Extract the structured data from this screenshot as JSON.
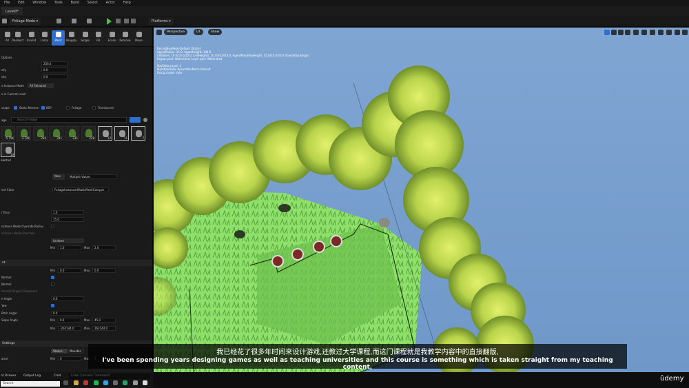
{
  "menu": [
    "File",
    "Edit",
    "Window",
    "Tools",
    "Build",
    "Select",
    "Actor",
    "Help"
  ],
  "level_tab": "Level0*",
  "toolbar": {
    "mode_dropdown": "Foliage Mode",
    "platforms": "Platforms"
  },
  "foliage_tools": [
    "All",
    "Deselect",
    "Invalid",
    "Lasso",
    "Paint",
    "Reapply",
    "Single",
    "Fill",
    "Erase",
    "Remove",
    "Move"
  ],
  "options": {
    "header": "Options",
    "radius_value": "256.0",
    "density_label": "city",
    "density_value": "0.0",
    "erase_label": "sity",
    "erase_value": "0.0",
    "single_mode_label": "e Instance Mode",
    "single_mode_value": "All Selected",
    "current_level_label": "e in Current Level"
  },
  "filters": {
    "landscape": "scape",
    "static_meshes": "Static Meshes",
    "bsp": "BSP",
    "foliage": "Foliage",
    "translucent": "Translucent"
  },
  "palette": {
    "header": "age",
    "search_placeholder": "Search Foliage",
    "items": [
      {
        "count": "5.75K",
        "kind": "plant"
      },
      {
        "count": "3.72K",
        "kind": "plant"
      },
      {
        "count": "236",
        "kind": "plant"
      },
      {
        "count": "241",
        "kind": "plant"
      },
      {
        "count": "231",
        "kind": "plant"
      },
      {
        "count": "228",
        "kind": "plant"
      },
      {
        "count": "12",
        "kind": "rock"
      },
      {
        "count": "11",
        "kind": "rock"
      },
      {
        "count": "7",
        "kind": "rock"
      },
      {
        "count": "10",
        "kind": "rock"
      }
    ],
    "selected_label": "elected"
  },
  "mesh": {
    "new_label": "New",
    "multiple_values": "Multiple Values",
    "component_class_label": "ent Class",
    "component_class_value": "FoliageInstancedStaticMeshCompon"
  },
  "painting": {
    "rows": [
      {
        "label": "/ Trice",
        "value": "1.0"
      },
      {
        "label": "",
        "value": "15.0"
      },
      {
        "label": "nstance Mode Override Radius",
        "value": ""
      },
      {
        "label": "instance Mode Override",
        "value": ""
      }
    ],
    "uniform": "Uniform",
    "min_label": "Min",
    "min_value": "1.0",
    "max_label": "Max",
    "max_value": "2.0"
  },
  "placement": {
    "header": "nt",
    "z_offset_min": "0.0",
    "z_offset_max": "0.0",
    "rows": [
      "Normal",
      "Normal",
      "Normal Single Component",
      "e Angle",
      "Yaw",
      "Pitch Angle",
      "Slope Angle"
    ],
    "align_angle": "0.0",
    "pitch_value": "0.0",
    "slope_min": "0.0",
    "slope_max": "45.0",
    "height_min": "-262144.0",
    "height_max": "262144.0"
  },
  "settings": {
    "header": "Settings",
    "statics": "Statics",
    "movable": "Movable",
    "distance_label": "ance",
    "distance_min": "0",
    "distance_max": "0"
  },
  "bottom": {
    "content_drawer": "nt Drawer",
    "output_log": "Output Log",
    "cmd": "Cmd",
    "cmd_placeholder": "Enter Console Command",
    "search": "Search"
  },
  "viewport": {
    "perspective": "Perspective",
    "lit": "Lit",
    "show": "Show",
    "stats": [
      "RecastNavMesh-Default (Static)",
      "AgentRadius: 35.0, AgentHeight: 144.0",
      "CellSizes: 10.0/10.0/10.0, CellHeights: 10.0/10.0/10.0, AgentMaxStepHeight: 35.0/35.0/35.0 (low/default/high)",
      "Region part: Watershed, Layer part: Watershed",
      "",
      "NavData count: 1",
      "MainNavData: RecastNavMesh-Default",
      "Using cluster links"
    ]
  },
  "subtitles": {
    "cn": "我已经花了很多年时间来设计游戏,还教过大学课程,而这门课程就是我教学内容中的直接翻版,",
    "en": "I've been spending years designing games as well as teaching universities and this course is something which is taken straight from my teaching content,"
  },
  "brand": "ûdemy",
  "colors": {
    "accent": "#2e6fd0",
    "sky": "#7fa5d3",
    "grass": "#8fdc6a",
    "play": "#49c442"
  }
}
